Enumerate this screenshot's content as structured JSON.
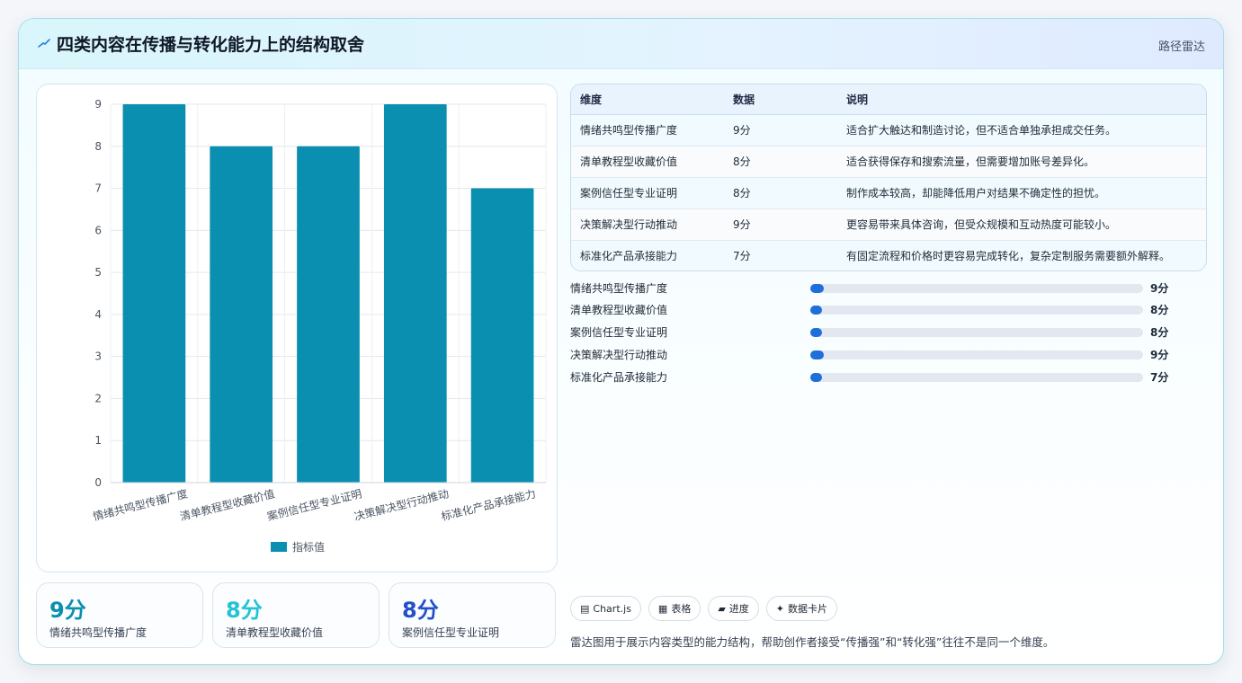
{
  "header": {
    "title": "四类内容在传播与转化能力上的结构取舍",
    "tag": "路径雷达"
  },
  "chart_data": {
    "type": "bar",
    "categories": [
      "情绪共鸣型传播广度",
      "清单教程型收藏价值",
      "案例信任型专业证明",
      "决策解决型行动推动",
      "标准化产品承接能力"
    ],
    "series": [
      {
        "name": "指标值",
        "values": [
          9,
          8,
          8,
          9,
          7
        ]
      }
    ],
    "ylim": [
      0,
      9
    ],
    "yticks": [
      "0",
      "1",
      "2",
      "3",
      "4",
      "5",
      "6",
      "7",
      "8",
      "9"
    ],
    "grid": true,
    "legend": "bottom",
    "bar_color": "#0a8fb0"
  },
  "stats": [
    {
      "value": "9分",
      "label": "情绪共鸣型传播广度",
      "color": "#0a8fb0"
    },
    {
      "value": "8分",
      "label": "清单教程型收藏价值",
      "color": "#22c3d6"
    },
    {
      "value": "8分",
      "label": "案例信任型专业证明",
      "color": "#2150c8"
    }
  ],
  "table": {
    "headers": [
      "维度",
      "数据",
      "说明"
    ],
    "rows": [
      [
        "情绪共鸣型传播广度",
        "9分",
        "适合扩大触达和制造讨论，但不适合单独承担成交任务。"
      ],
      [
        "清单教程型收藏价值",
        "8分",
        "适合获得保存和搜索流量，但需要增加账号差异化。"
      ],
      [
        "案例信任型专业证明",
        "8分",
        "制作成本较高，却能降低用户对结果不确定性的担忧。"
      ],
      [
        "决策解决型行动推动",
        "9分",
        "更容易带来具体咨询，但受众规模和互动热度可能较小。"
      ],
      [
        "标准化产品承接能力",
        "7分",
        "有固定流程和价格时更容易完成转化，复杂定制服务需要额外解释。"
      ]
    ]
  },
  "progress": [
    {
      "label": "情绪共鸣型传播广度",
      "value": "9分",
      "fraction": 0.04
    },
    {
      "label": "清单教程型收藏价值",
      "value": "8分",
      "fraction": 0.035
    },
    {
      "label": "案例信任型专业证明",
      "value": "8分",
      "fraction": 0.035
    },
    {
      "label": "决策解决型行动推动",
      "value": "9分",
      "fraction": 0.04
    },
    {
      "label": "标准化产品承接能力",
      "value": "7分",
      "fraction": 0.033
    }
  ],
  "buttons": [
    {
      "icon": "▤",
      "label": "Chart.js"
    },
    {
      "icon": "▦",
      "label": "表格"
    },
    {
      "icon": "▰",
      "label": "进度"
    },
    {
      "icon": "✦",
      "label": "数据卡片"
    }
  ],
  "note": "雷达图用于展示内容类型的能力结构，帮助创作者接受“传播强”和“转化强”往往不是同一个维度。"
}
